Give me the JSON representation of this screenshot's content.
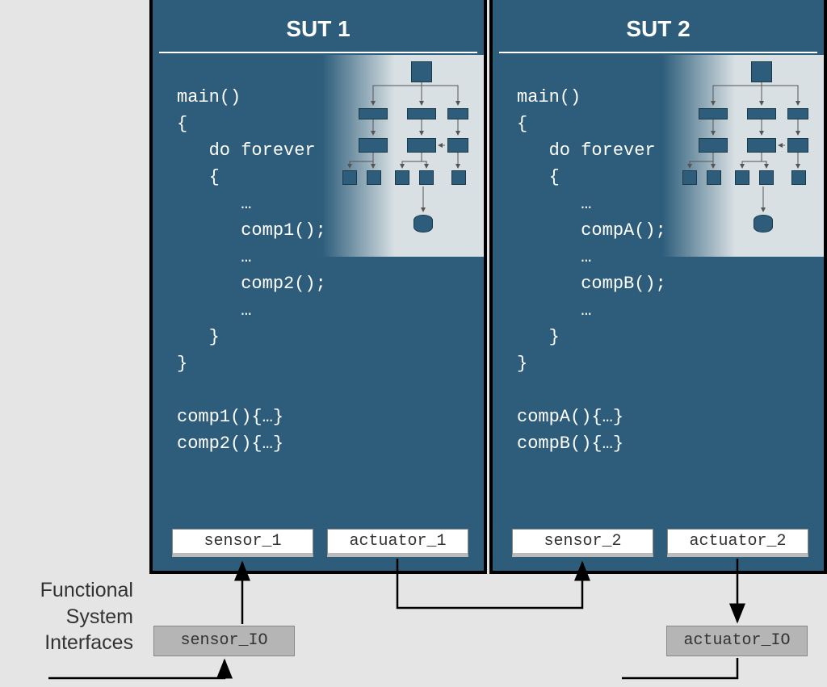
{
  "sut1": {
    "title": "SUT 1",
    "code": "main()\n{\n   do forever\n   {\n      …\n      comp1();\n      …\n      comp2();\n      …\n   }\n}\n\ncomp1(){…}\ncomp2(){…}",
    "sensor": "sensor_1",
    "actuator": "actuator_1"
  },
  "sut2": {
    "title": "SUT 2",
    "code": "main()\n{\n   do forever\n   {\n      …\n      compA();\n      …\n      compB();\n      …\n   }\n}\n\ncompA(){…}\ncompB(){…}",
    "sensor": "sensor_2",
    "actuator": "actuator_2"
  },
  "sensor_io": "sensor_IO",
  "actuator_io": "actuator_IO",
  "side_label": "Functional\nSystem\nInterfaces"
}
